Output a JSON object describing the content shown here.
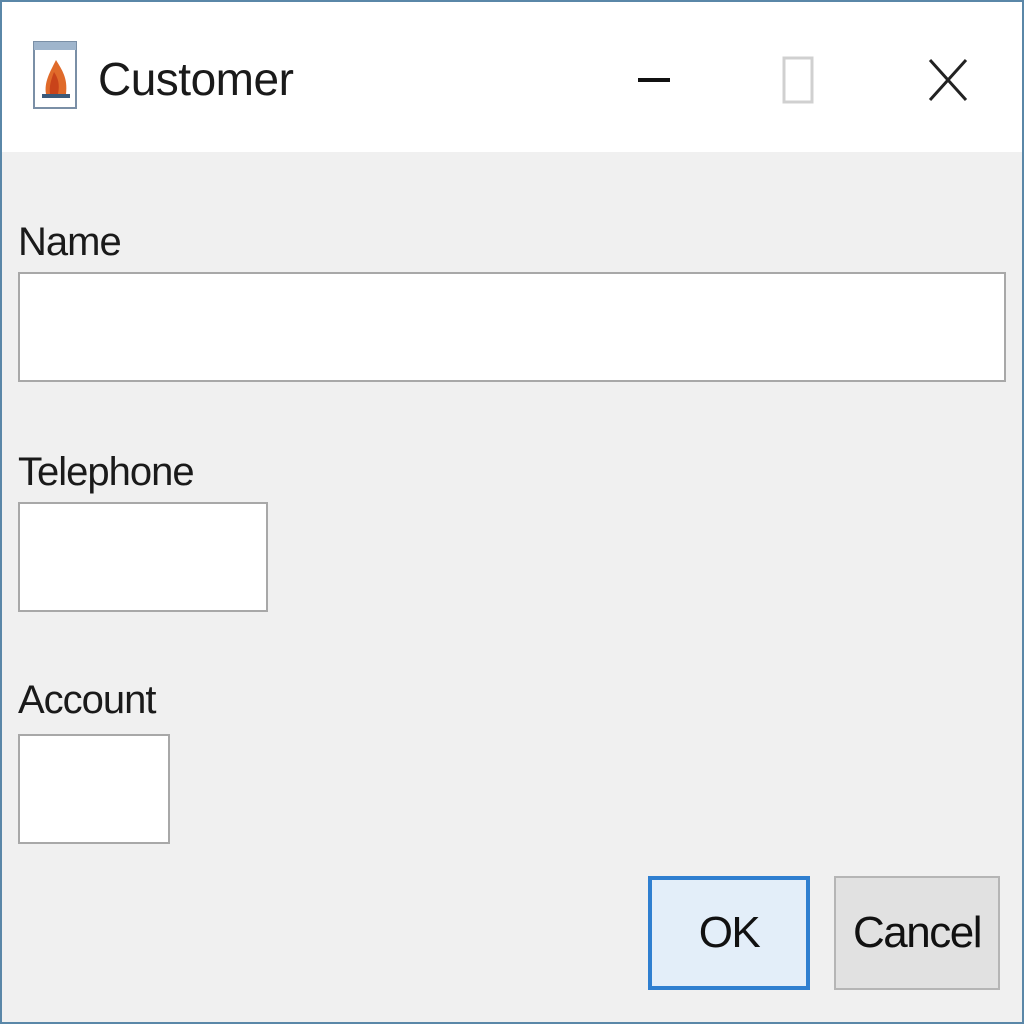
{
  "window": {
    "title": "Customer",
    "controls": {
      "minimize_icon": "minimize-icon",
      "maximize_icon": "maximize-icon",
      "close_icon": "close-icon"
    },
    "app_icon": "java-app-icon"
  },
  "form": {
    "name": {
      "label": "Name",
      "value": ""
    },
    "telephone": {
      "label": "Telephone",
      "value": ""
    },
    "account": {
      "label": "Account",
      "value": ""
    }
  },
  "buttons": {
    "ok_label": "OK",
    "cancel_label": "Cancel"
  },
  "colors": {
    "window_border": "#5a87a8",
    "background": "#f0f0f0",
    "ok_focus_border": "#2f7fd0"
  }
}
